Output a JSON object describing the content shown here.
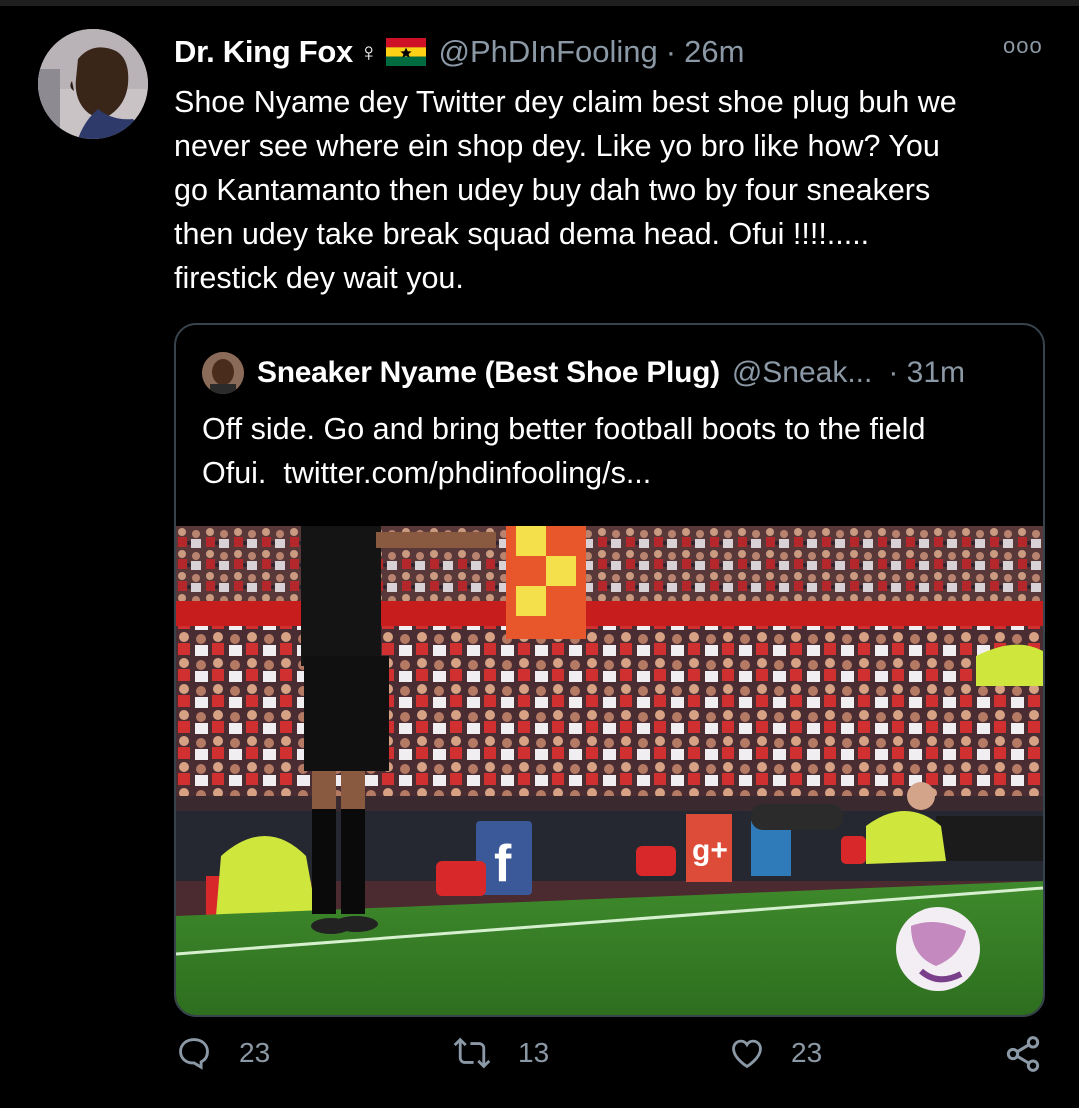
{
  "tweet": {
    "author_name": "Dr. King Fox",
    "name_symbol": "♀",
    "handle": "@PhDInFooling",
    "separator": "·",
    "time": "26m",
    "more_label": "ooo",
    "text_lines": [
      "Shoe Nyame dey Twitter dey claim best shoe plug buh we",
      "never see where ein shop dey. Like yo bro like how? You",
      "go Kantamanto then udey buy dah two by four sneakers",
      "then udey take break squad dema head. Ofui !!!!.....",
      "firestick dey wait you."
    ]
  },
  "quoted": {
    "author_name": "Sneaker Nyame (Best Shoe Plug)",
    "handle": "@Sneak...",
    "time": "· 31m",
    "text_line1": "Off side. Go and bring better football boots to the field",
    "text_line2_prefix": "Ofui.  ",
    "link": "twitter.com/phdinfooling/s..."
  },
  "actions": {
    "reply_count": "23",
    "retweet_count": "13",
    "like_count": "23"
  },
  "icons": [
    "reply-icon",
    "retweet-icon",
    "like-icon",
    "share-icon",
    "more-icon",
    "ghana-flag-icon"
  ],
  "colors": {
    "background": "#000000",
    "secondary_text": "#8b98a5",
    "border": "#38444d"
  }
}
